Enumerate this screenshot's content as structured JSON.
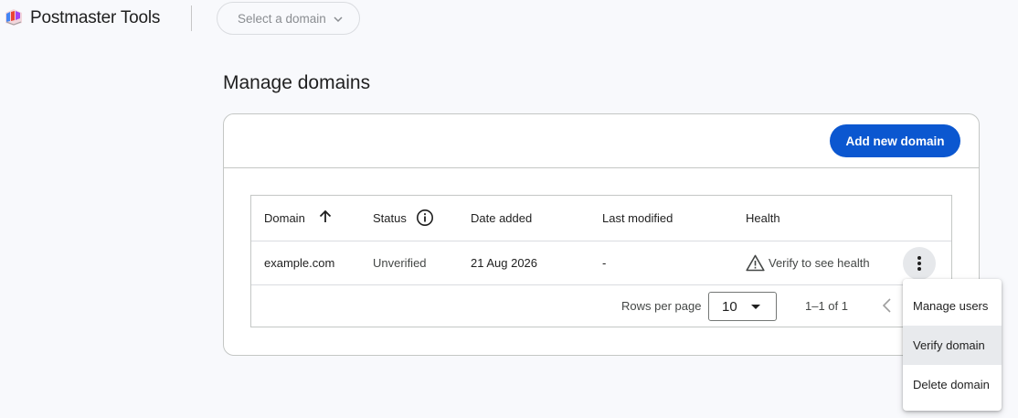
{
  "app": {
    "title": "Postmaster Tools",
    "logo_icon": "postmaster-logo-icon"
  },
  "domain_select": {
    "placeholder": "Select a domain",
    "icon": "chevron-down-icon"
  },
  "page": {
    "title": "Manage domains"
  },
  "toolbar": {
    "add_label": "Add new domain",
    "accent_color": "#0b57d0"
  },
  "table": {
    "headers": {
      "domain": "Domain",
      "status": "Status",
      "date_added": "Date added",
      "last_modified": "Last modified",
      "health": "Health"
    },
    "sort": {
      "column": "domain",
      "direction": "ascending",
      "icon": "arrow-up-icon"
    },
    "rows": [
      {
        "domain": "example.com",
        "status": "Unverified",
        "date_added": "21 Aug 2026",
        "last_modified": "-",
        "health": "Verify to see health",
        "health_icon": "warning-icon"
      }
    ],
    "footer": {
      "rows_per_page_label": "Rows per page",
      "rows_per_page_value": "10",
      "range": "1–1 of 1"
    }
  },
  "row_menu": {
    "items": [
      {
        "label": "Manage users"
      },
      {
        "label": "Verify domain",
        "highlighted": true
      },
      {
        "label": "Delete domain"
      }
    ]
  }
}
